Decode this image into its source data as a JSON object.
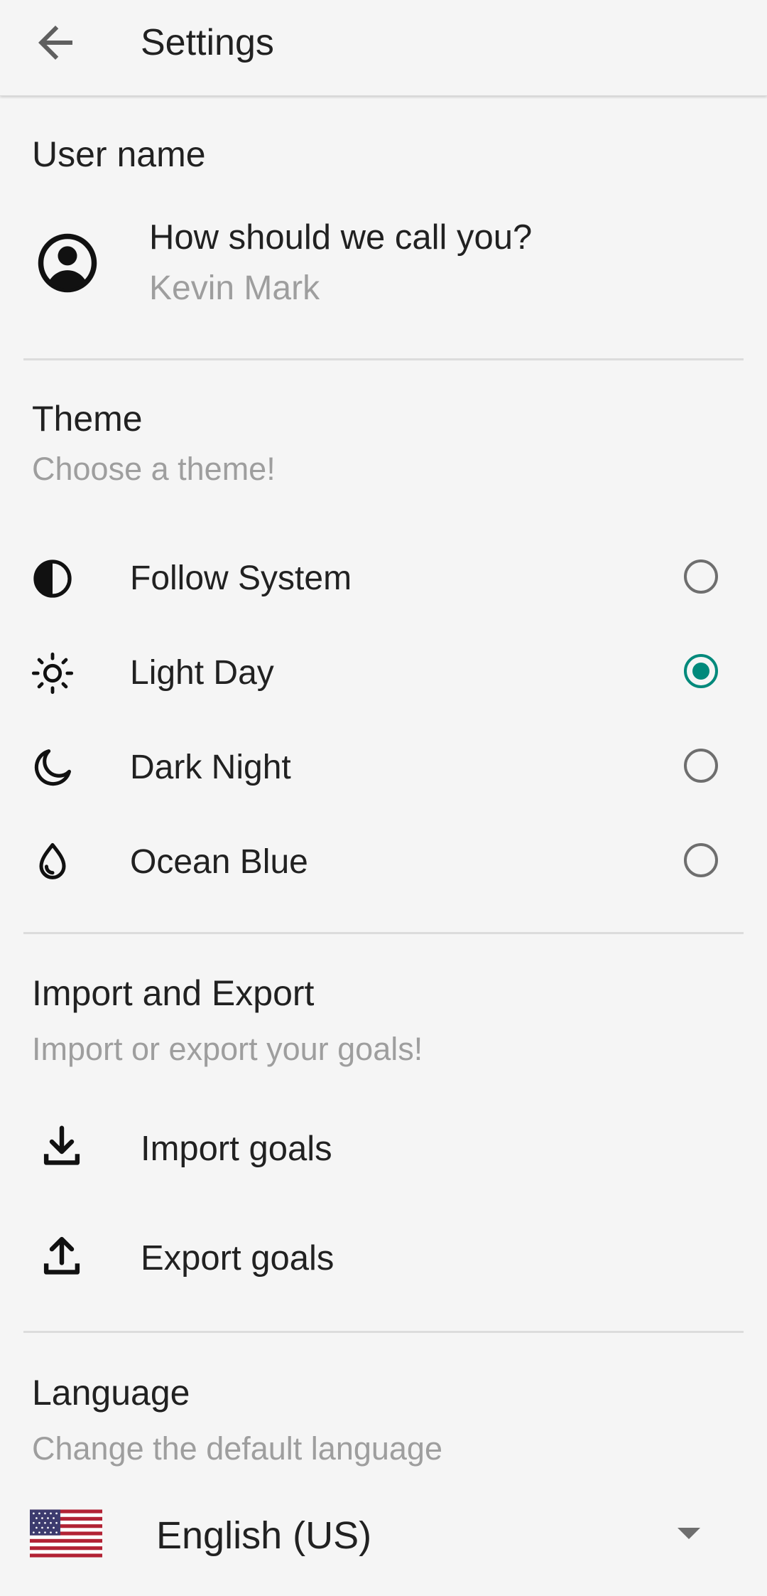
{
  "header": {
    "title": "Settings",
    "back_icon": "arrow-back-icon"
  },
  "user_section": {
    "title": "User name",
    "prompt": "How should we call you?",
    "value": "Kevin Mark",
    "icon": "account-circle-icon"
  },
  "theme_section": {
    "title": "Theme",
    "subtitle": "Choose a theme!",
    "accent_color": "#00897b",
    "selected": "Light Day",
    "options": [
      {
        "label": "Follow System",
        "icon": "contrast-icon",
        "selected": false
      },
      {
        "label": "Light Day",
        "icon": "sun-icon",
        "selected": true
      },
      {
        "label": "Dark Night",
        "icon": "moon-icon",
        "selected": false
      },
      {
        "label": "Ocean Blue",
        "icon": "water-drop-icon",
        "selected": false
      }
    ]
  },
  "import_export_section": {
    "title": "Import and Export",
    "subtitle": "Import or export your goals!",
    "import_label": "Import goals",
    "export_label": "Export goals"
  },
  "language_section": {
    "title": "Language",
    "subtitle": "Change the default language",
    "selected": "English (US)",
    "flag_icon": "us-flag-icon"
  }
}
